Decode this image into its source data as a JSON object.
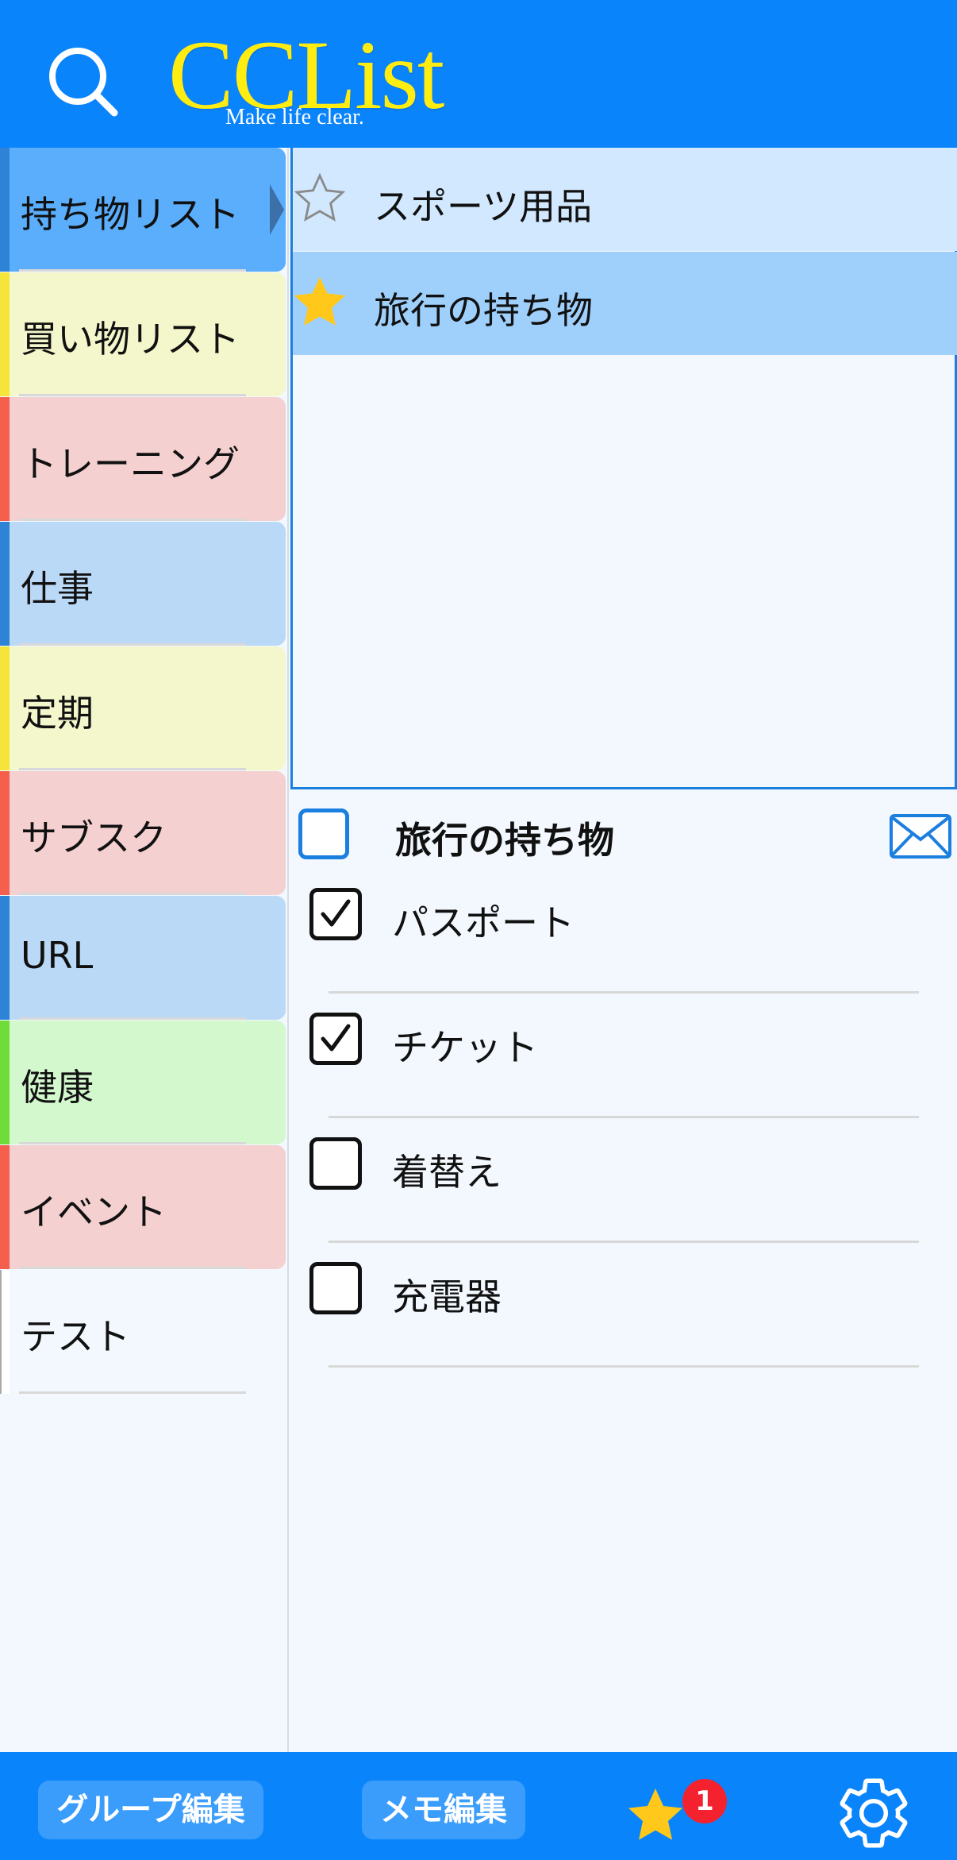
{
  "app": {
    "logo_text": "CCList",
    "tagline": "Make life clear."
  },
  "colors": {
    "header_bg": "#0a84fb",
    "accent": "#1b7fe0",
    "star_filled": "#ffc81a",
    "badge": "#f4222f"
  },
  "sidebar": {
    "groups": [
      {
        "label": "持ち物リスト",
        "stripe": "#2f83d6",
        "bg": "#5aaefb",
        "selected": true
      },
      {
        "label": "買い物リスト",
        "stripe": "#f5e43a",
        "bg": "#f4f7cb",
        "selected": false
      },
      {
        "label": "トレーニング",
        "stripe": "#f4604d",
        "bg": "#f5d0d0",
        "selected": false
      },
      {
        "label": "仕事",
        "stripe": "#2f83d6",
        "bg": "#bad9f6",
        "selected": false
      },
      {
        "label": "定期",
        "stripe": "#f5e43a",
        "bg": "#f4f7cb",
        "selected": false
      },
      {
        "label": "サブスク",
        "stripe": "#f4604d",
        "bg": "#f5d0d0",
        "selected": false
      },
      {
        "label": "URL",
        "stripe": "#2f83d6",
        "bg": "#bad9f6",
        "selected": false
      },
      {
        "label": "健康",
        "stripe": "#6fdc3a",
        "bg": "#d3f8ce",
        "selected": false
      },
      {
        "label": "イベント",
        "stripe": "#f4604d",
        "bg": "#f5d0d0",
        "selected": false
      },
      {
        "label": "テスト",
        "stripe": "#ffffff",
        "bg": "#f2f8fe",
        "selected": false
      }
    ]
  },
  "memos": {
    "items": [
      {
        "label": "スポーツ用品",
        "starred": false,
        "bg": "#d1e8fe"
      },
      {
        "label": "旅行の持ち物",
        "starred": true,
        "bg": "#9fd0fc"
      }
    ]
  },
  "detail": {
    "title": "旅行の持ち物",
    "items": [
      {
        "label": "パスポート",
        "checked": true
      },
      {
        "label": "チケット",
        "checked": true
      },
      {
        "label": "着替え",
        "checked": false
      },
      {
        "label": "充電器",
        "checked": false
      }
    ]
  },
  "footer": {
    "group_edit": "グループ編集",
    "memo_edit": "メモ編集",
    "favorites_badge": "1"
  }
}
